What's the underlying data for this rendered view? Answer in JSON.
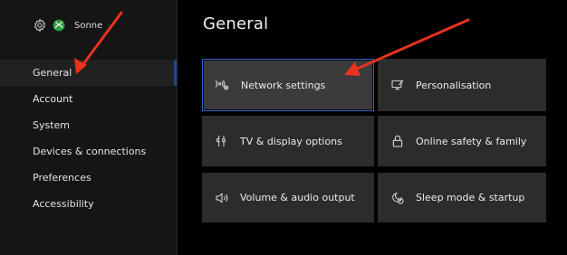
{
  "profile": {
    "gamertag": "Sonne",
    "icons": [
      "gear-icon",
      "xbox-logo-icon"
    ]
  },
  "sidebar": {
    "items": [
      {
        "label": "General",
        "selected": true
      },
      {
        "label": "Account",
        "selected": false
      },
      {
        "label": "System",
        "selected": false
      },
      {
        "label": "Devices & connections",
        "selected": false
      },
      {
        "label": "Preferences",
        "selected": false
      },
      {
        "label": "Accessibility",
        "selected": false
      }
    ]
  },
  "main": {
    "title": "General",
    "tiles": [
      {
        "label": "Network settings",
        "icon": "network-icon",
        "focused": true
      },
      {
        "label": "Personalisation",
        "icon": "personalisation-icon",
        "focused": false
      },
      {
        "label": "TV & display options",
        "icon": "tv-display-icon",
        "focused": false
      },
      {
        "label": "Online safety & family",
        "icon": "lock-icon",
        "focused": false
      },
      {
        "label": "Volume & audio output",
        "icon": "speaker-icon",
        "focused": false
      },
      {
        "label": "Sleep mode & startup",
        "icon": "sleep-power-icon",
        "focused": false
      }
    ]
  },
  "colors": {
    "background": "#000000",
    "sidebar": "#151515",
    "tile": "#2c2c2c",
    "tile_focused": "#3b3b3b",
    "focus_border": "#2e62c9",
    "annotation_arrow": "#e8321e"
  }
}
